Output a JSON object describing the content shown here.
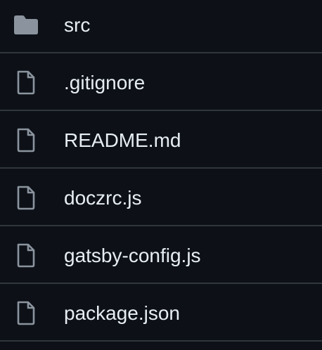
{
  "files": [
    {
      "name": "src",
      "icon": "folder-icon"
    },
    {
      "name": ".gitignore",
      "icon": "file-icon"
    },
    {
      "name": "README.md",
      "icon": "file-icon"
    },
    {
      "name": "doczrc.js",
      "icon": "file-icon"
    },
    {
      "name": "gatsby-config.js",
      "icon": "file-icon"
    },
    {
      "name": "package.json",
      "icon": "file-icon"
    }
  ],
  "colors": {
    "background": "#0d1117",
    "divider": "#30363d",
    "text": "#e6edf3",
    "folder_icon": "#8b949e",
    "file_icon": "#8b949e"
  }
}
